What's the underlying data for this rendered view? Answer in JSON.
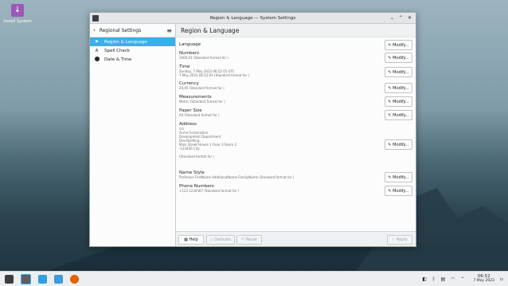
{
  "desktop": {
    "icon_label": "Install System"
  },
  "window": {
    "title": "Region & Language — System Settings",
    "controls": {
      "minimize": "⌄",
      "maximize": "⌃",
      "close": "✕"
    }
  },
  "sidebar": {
    "title": "Regional Settings",
    "items": [
      {
        "label": "Region & Language"
      },
      {
        "label": "Spell Check"
      },
      {
        "label": "Date & Time"
      }
    ]
  },
  "main": {
    "title": "Region & Language",
    "modify_label": "Modify...",
    "settings": [
      {
        "label": "Language",
        "lines": []
      },
      {
        "label": "Numbers",
        "lines": [
          "1000,01 (Standard format for )"
        ]
      },
      {
        "label": "Time",
        "lines": [
          "Sunday, 7 May 2023 06:52:01 UTC",
          "7 May 2023 06:52:01 (Standard format for )"
        ]
      },
      {
        "label": "Currency",
        "lines": [
          "24,00 (Standard format for )"
        ]
      },
      {
        "label": "Measurements",
        "lines": [
          "Metric (Standard format for )"
        ]
      },
      {
        "label": "Paper Size",
        "lines": [
          "A4 (Standard format for )"
        ]
      },
      {
        "label": "Address",
        "lines": [
          "c/o",
          "Acme Corporation",
          "Development Department",
          "Dev-Building",
          "Main Street House 1 Floor 3 Room 2",
          "-123456 City",
          "",
          "(Standard format for )"
        ]
      },
      {
        "label": "Name Style",
        "lines": [
          "Professor FirstName AdditionalName FamilyName (Standard format for )"
        ]
      },
      {
        "label": "Phone Numbers",
        "lines": [
          "+123 1234567 (Standard format for )"
        ]
      }
    ]
  },
  "footer": {
    "help": "Help",
    "defaults": "Defaults",
    "reset": "Reset",
    "apply": "Apply"
  },
  "taskbar": {
    "time": "06:52",
    "date": "7 May 2023"
  },
  "colors": {
    "accent": "#3daee9",
    "purple_icon": "#9b59b6"
  }
}
